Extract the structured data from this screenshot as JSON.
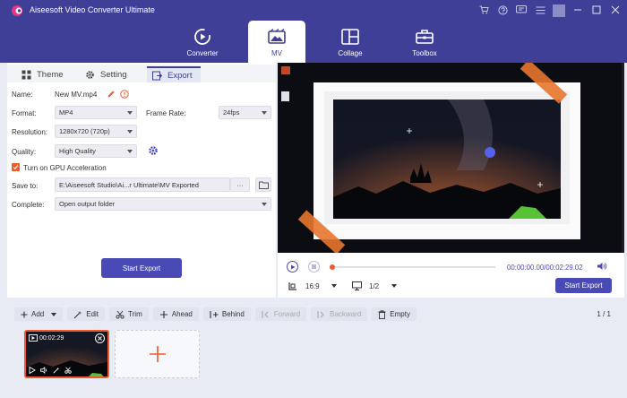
{
  "app": {
    "title": "Aiseesoft Video Converter Ultimate"
  },
  "nav": {
    "converter": "Converter",
    "mv": "MV",
    "collage": "Collage",
    "toolbox": "Toolbox"
  },
  "subtabs": {
    "theme": "Theme",
    "setting": "Setting",
    "export": "Export"
  },
  "export": {
    "name_label": "Name:",
    "name_value": "New MV.mp4",
    "format_label": "Format:",
    "format_value": "MP4",
    "frame_rate_label": "Frame Rate:",
    "frame_rate_value": "24fps",
    "resolution_label": "Resolution:",
    "resolution_value": "1280x720 (720p)",
    "quality_label": "Quality:",
    "quality_value": "High Quality",
    "gpu_label": "Turn on GPU Acceleration",
    "save_label": "Save to:",
    "save_value": "E:\\Aiseesoft Studio\\Ai...r Ultimate\\MV Exported",
    "browse_label": "···",
    "complete_label": "Complete:",
    "complete_value": "Open output folder",
    "start_button": "Start Export"
  },
  "player": {
    "time": "00:00:00.00/00:02:29.02",
    "aspect": "16:9",
    "page": "1/2",
    "start_button": "Start Export",
    "progress": 0.0
  },
  "toolbar": {
    "add": "Add",
    "edit": "Edit",
    "trim": "Trim",
    "ahead": "Ahead",
    "behind": "Behind",
    "forward": "Forward",
    "backward": "Backward",
    "empty": "Empty",
    "page_count": "1 / 1"
  },
  "clip": {
    "duration": "00:02:29"
  },
  "colors": {
    "accent": "#4a4ab6",
    "header": "#3f3f97",
    "highlight": "#ef5a2a"
  }
}
